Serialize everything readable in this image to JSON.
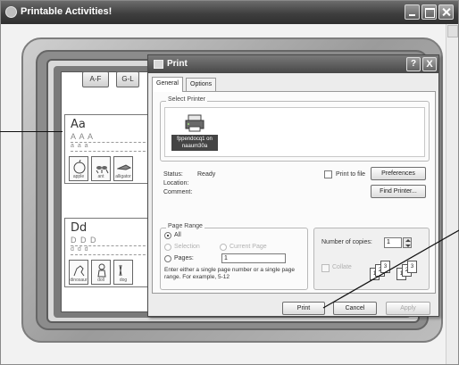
{
  "app": {
    "title": "Printable Activities!"
  },
  "book": {
    "tabs": [
      "A-F",
      "G-L"
    ],
    "sheet1": {
      "letters": "Aa",
      "trace": "A A A",
      "trace_small": "a a a",
      "captions": [
        "apple",
        "ant",
        "alligator"
      ]
    },
    "sheet2": {
      "letters": "Dd",
      "trace": "D D D",
      "trace_small": "d d d",
      "captions": [
        "dinosaur",
        "doll",
        "dog"
      ]
    }
  },
  "dialog": {
    "title": "Print",
    "help_label": "?",
    "close_label": "X",
    "tabs": {
      "general": "General",
      "options": "Options"
    },
    "select_printer": {
      "label": "Select Printer",
      "printer_name_line1": "fppendocq1 on",
      "printer_name_line2": "naaum30a"
    },
    "status": {
      "status_label": "Status:",
      "status_value": "Ready",
      "location_label": "Location:",
      "comment_label": "Comment:"
    },
    "print_to_file_label": "Print to file",
    "preferences_label": "Preferences",
    "find_printer_label": "Find Printer...",
    "page_range": {
      "label": "Page Range",
      "all_label": "All",
      "selection_label": "Selection",
      "current_page_label": "Current Page",
      "pages_label": "Pages:",
      "pages_value": "1",
      "hint": "Enter either a single page number or a single page range.  For example, 5-12"
    },
    "copies": {
      "label": "Number of copies:",
      "value": "1",
      "collate_label": "Collate",
      "collate_pages": [
        "1",
        "2",
        "3",
        "1",
        "2",
        "3"
      ]
    },
    "buttons": {
      "print": "Print",
      "cancel": "Cancel",
      "apply": "Apply"
    }
  }
}
